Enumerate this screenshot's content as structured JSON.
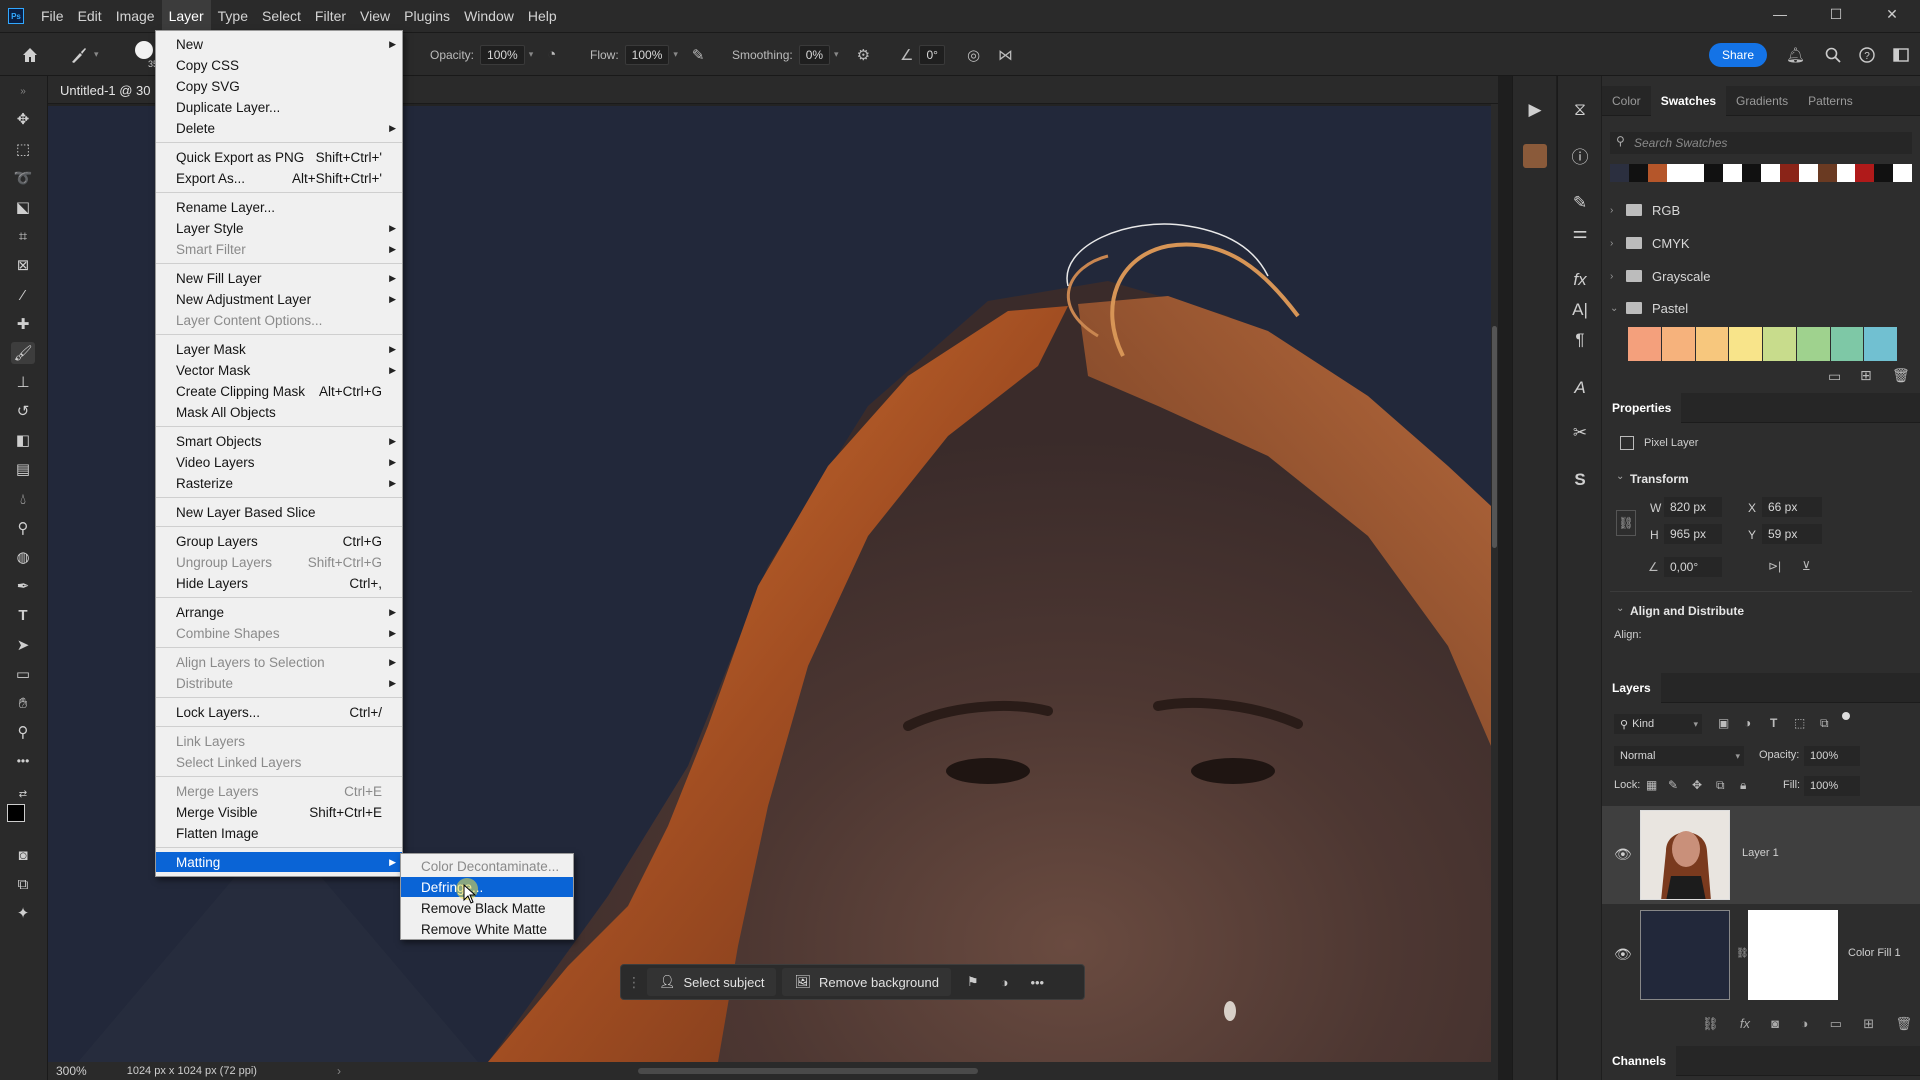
{
  "menubar": {
    "logo": "Ps",
    "items": [
      "File",
      "Edit",
      "Image",
      "Layer",
      "Type",
      "Select",
      "Filter",
      "View",
      "Plugins",
      "Window",
      "Help"
    ],
    "active": "Layer"
  },
  "window_controls": {
    "minimize": "—",
    "maximize": "☐",
    "close": "✕"
  },
  "options": {
    "brush_size": "35",
    "opacity_label": "Opacity:",
    "opacity_value": "100%",
    "flow_label": "Flow:",
    "flow_value": "100%",
    "smoothing_label": "Smoothing:",
    "smoothing_value": "0%",
    "angle_value": "0°",
    "share_label": "Share"
  },
  "document": {
    "tab_title": "Untitled-1 @ 30",
    "zoom": "300%",
    "info": "1024 px x 1024 px (72 ppi)"
  },
  "context_bar": {
    "select_subject": "Select subject",
    "remove_background": "Remove background"
  },
  "layer_menu": {
    "items": [
      {
        "label": "New",
        "shortcut": "",
        "submenu": true,
        "disabled": false
      },
      {
        "label": "Copy CSS",
        "shortcut": "",
        "submenu": false,
        "disabled": false
      },
      {
        "label": "Copy SVG",
        "shortcut": "",
        "submenu": false,
        "disabled": false
      },
      {
        "label": "Duplicate Layer...",
        "shortcut": "",
        "submenu": false,
        "disabled": false
      },
      {
        "label": "Delete",
        "shortcut": "",
        "submenu": true,
        "disabled": false
      },
      {
        "label": "Quick Export as PNG",
        "shortcut": "Shift+Ctrl+'",
        "submenu": false,
        "disabled": false
      },
      {
        "label": "Export As...",
        "shortcut": "Alt+Shift+Ctrl+'",
        "submenu": false,
        "disabled": false
      },
      {
        "label": "Rename Layer...",
        "shortcut": "",
        "submenu": false,
        "disabled": false
      },
      {
        "label": "Layer Style",
        "shortcut": "",
        "submenu": true,
        "disabled": false
      },
      {
        "label": "Smart Filter",
        "shortcut": "",
        "submenu": true,
        "disabled": true
      },
      {
        "label": "New Fill Layer",
        "shortcut": "",
        "submenu": true,
        "disabled": false
      },
      {
        "label": "New Adjustment Layer",
        "shortcut": "",
        "submenu": true,
        "disabled": false
      },
      {
        "label": "Layer Content Options...",
        "shortcut": "",
        "submenu": false,
        "disabled": true
      },
      {
        "label": "Layer Mask",
        "shortcut": "",
        "submenu": true,
        "disabled": false
      },
      {
        "label": "Vector Mask",
        "shortcut": "",
        "submenu": true,
        "disabled": false
      },
      {
        "label": "Create Clipping Mask",
        "shortcut": "Alt+Ctrl+G",
        "submenu": false,
        "disabled": false
      },
      {
        "label": "Mask All Objects",
        "shortcut": "",
        "submenu": false,
        "disabled": false
      },
      {
        "label": "Smart Objects",
        "shortcut": "",
        "submenu": true,
        "disabled": false
      },
      {
        "label": "Video Layers",
        "shortcut": "",
        "submenu": true,
        "disabled": false
      },
      {
        "label": "Rasterize",
        "shortcut": "",
        "submenu": true,
        "disabled": false
      },
      {
        "label": "New Layer Based Slice",
        "shortcut": "",
        "submenu": false,
        "disabled": false
      },
      {
        "label": "Group Layers",
        "shortcut": "Ctrl+G",
        "submenu": false,
        "disabled": false
      },
      {
        "label": "Ungroup Layers",
        "shortcut": "Shift+Ctrl+G",
        "submenu": false,
        "disabled": true
      },
      {
        "label": "Hide Layers",
        "shortcut": "Ctrl+,",
        "submenu": false,
        "disabled": false
      },
      {
        "label": "Arrange",
        "shortcut": "",
        "submenu": true,
        "disabled": false
      },
      {
        "label": "Combine Shapes",
        "shortcut": "",
        "submenu": true,
        "disabled": true
      },
      {
        "label": "Align Layers to Selection",
        "shortcut": "",
        "submenu": true,
        "disabled": true
      },
      {
        "label": "Distribute",
        "shortcut": "",
        "submenu": true,
        "disabled": true
      },
      {
        "label": "Lock Layers...",
        "shortcut": "Ctrl+/",
        "submenu": false,
        "disabled": false
      },
      {
        "label": "Link Layers",
        "shortcut": "",
        "submenu": false,
        "disabled": true
      },
      {
        "label": "Select Linked Layers",
        "shortcut": "",
        "submenu": false,
        "disabled": true
      },
      {
        "label": "Merge Layers",
        "shortcut": "Ctrl+E",
        "submenu": false,
        "disabled": true
      },
      {
        "label": "Merge Visible",
        "shortcut": "Shift+Ctrl+E",
        "submenu": false,
        "disabled": false
      },
      {
        "label": "Flatten Image",
        "shortcut": "",
        "submenu": false,
        "disabled": false
      },
      {
        "label": "Matting",
        "shortcut": "",
        "submenu": true,
        "disabled": false,
        "highlighted": true
      }
    ]
  },
  "matting_menu": {
    "items": [
      {
        "label": "Color Decontaminate...",
        "disabled": true
      },
      {
        "label": "Defringe...",
        "disabled": false,
        "highlighted": true
      },
      {
        "label": "Remove Black Matte",
        "disabled": false
      },
      {
        "label": "Remove White Matte",
        "disabled": false
      }
    ]
  },
  "swatches_panel": {
    "tabs": [
      "Color",
      "Swatches",
      "Gradients",
      "Patterns"
    ],
    "active_tab": "Swatches",
    "search_placeholder": "Search Swatches",
    "recent_colors": [
      "#2b2f3f",
      "#111111",
      "#b5562a",
      "#ffffff",
      "#ffffff",
      "#111111",
      "#ffffff",
      "#111111",
      "#ffffff",
      "#8a2418",
      "#ffffff",
      "#6a3a22",
      "#ffffff",
      "#b01a1a",
      "#111111",
      "#ffffff"
    ],
    "folders": [
      "RGB",
      "CMYK",
      "Grayscale",
      "Pastel"
    ],
    "pastel_colors": [
      "#f4a07c",
      "#f6b27c",
      "#f7c77d",
      "#f8e48a",
      "#c8dc8c",
      "#9fd28e",
      "#7ec8a6",
      "#71c0d1"
    ]
  },
  "properties_panel": {
    "title": "Properties",
    "layer_type": "Pixel Layer",
    "transform_title": "Transform",
    "w_label": "W",
    "w_value": "820 px",
    "x_label": "X",
    "x_value": "66 px",
    "h_label": "H",
    "h_value": "965 px",
    "y_label": "Y",
    "y_value": "59 px",
    "angle_value": "0,00°",
    "align_title": "Align and Distribute",
    "align_label": "Align:"
  },
  "layers_panel": {
    "title": "Layers",
    "filter_label": "Kind",
    "blend_mode": "Normal",
    "opacity_label": "Opacity:",
    "opacity_value": "100%",
    "lock_label": "Lock:",
    "fill_label": "Fill:",
    "fill_value": "100%",
    "layers": [
      {
        "name": "Layer 1",
        "visible": true
      },
      {
        "name": "Color Fill 1",
        "visible": true
      }
    ]
  },
  "channels_panel": {
    "title": "Channels"
  },
  "icons": {
    "home": "⌂",
    "move": "✥",
    "marquee": "⬚",
    "lasso": "➰",
    "brush": "🖌",
    "type": "T",
    "zoom": "🔍",
    "hand": "✋",
    "more": "•••"
  }
}
